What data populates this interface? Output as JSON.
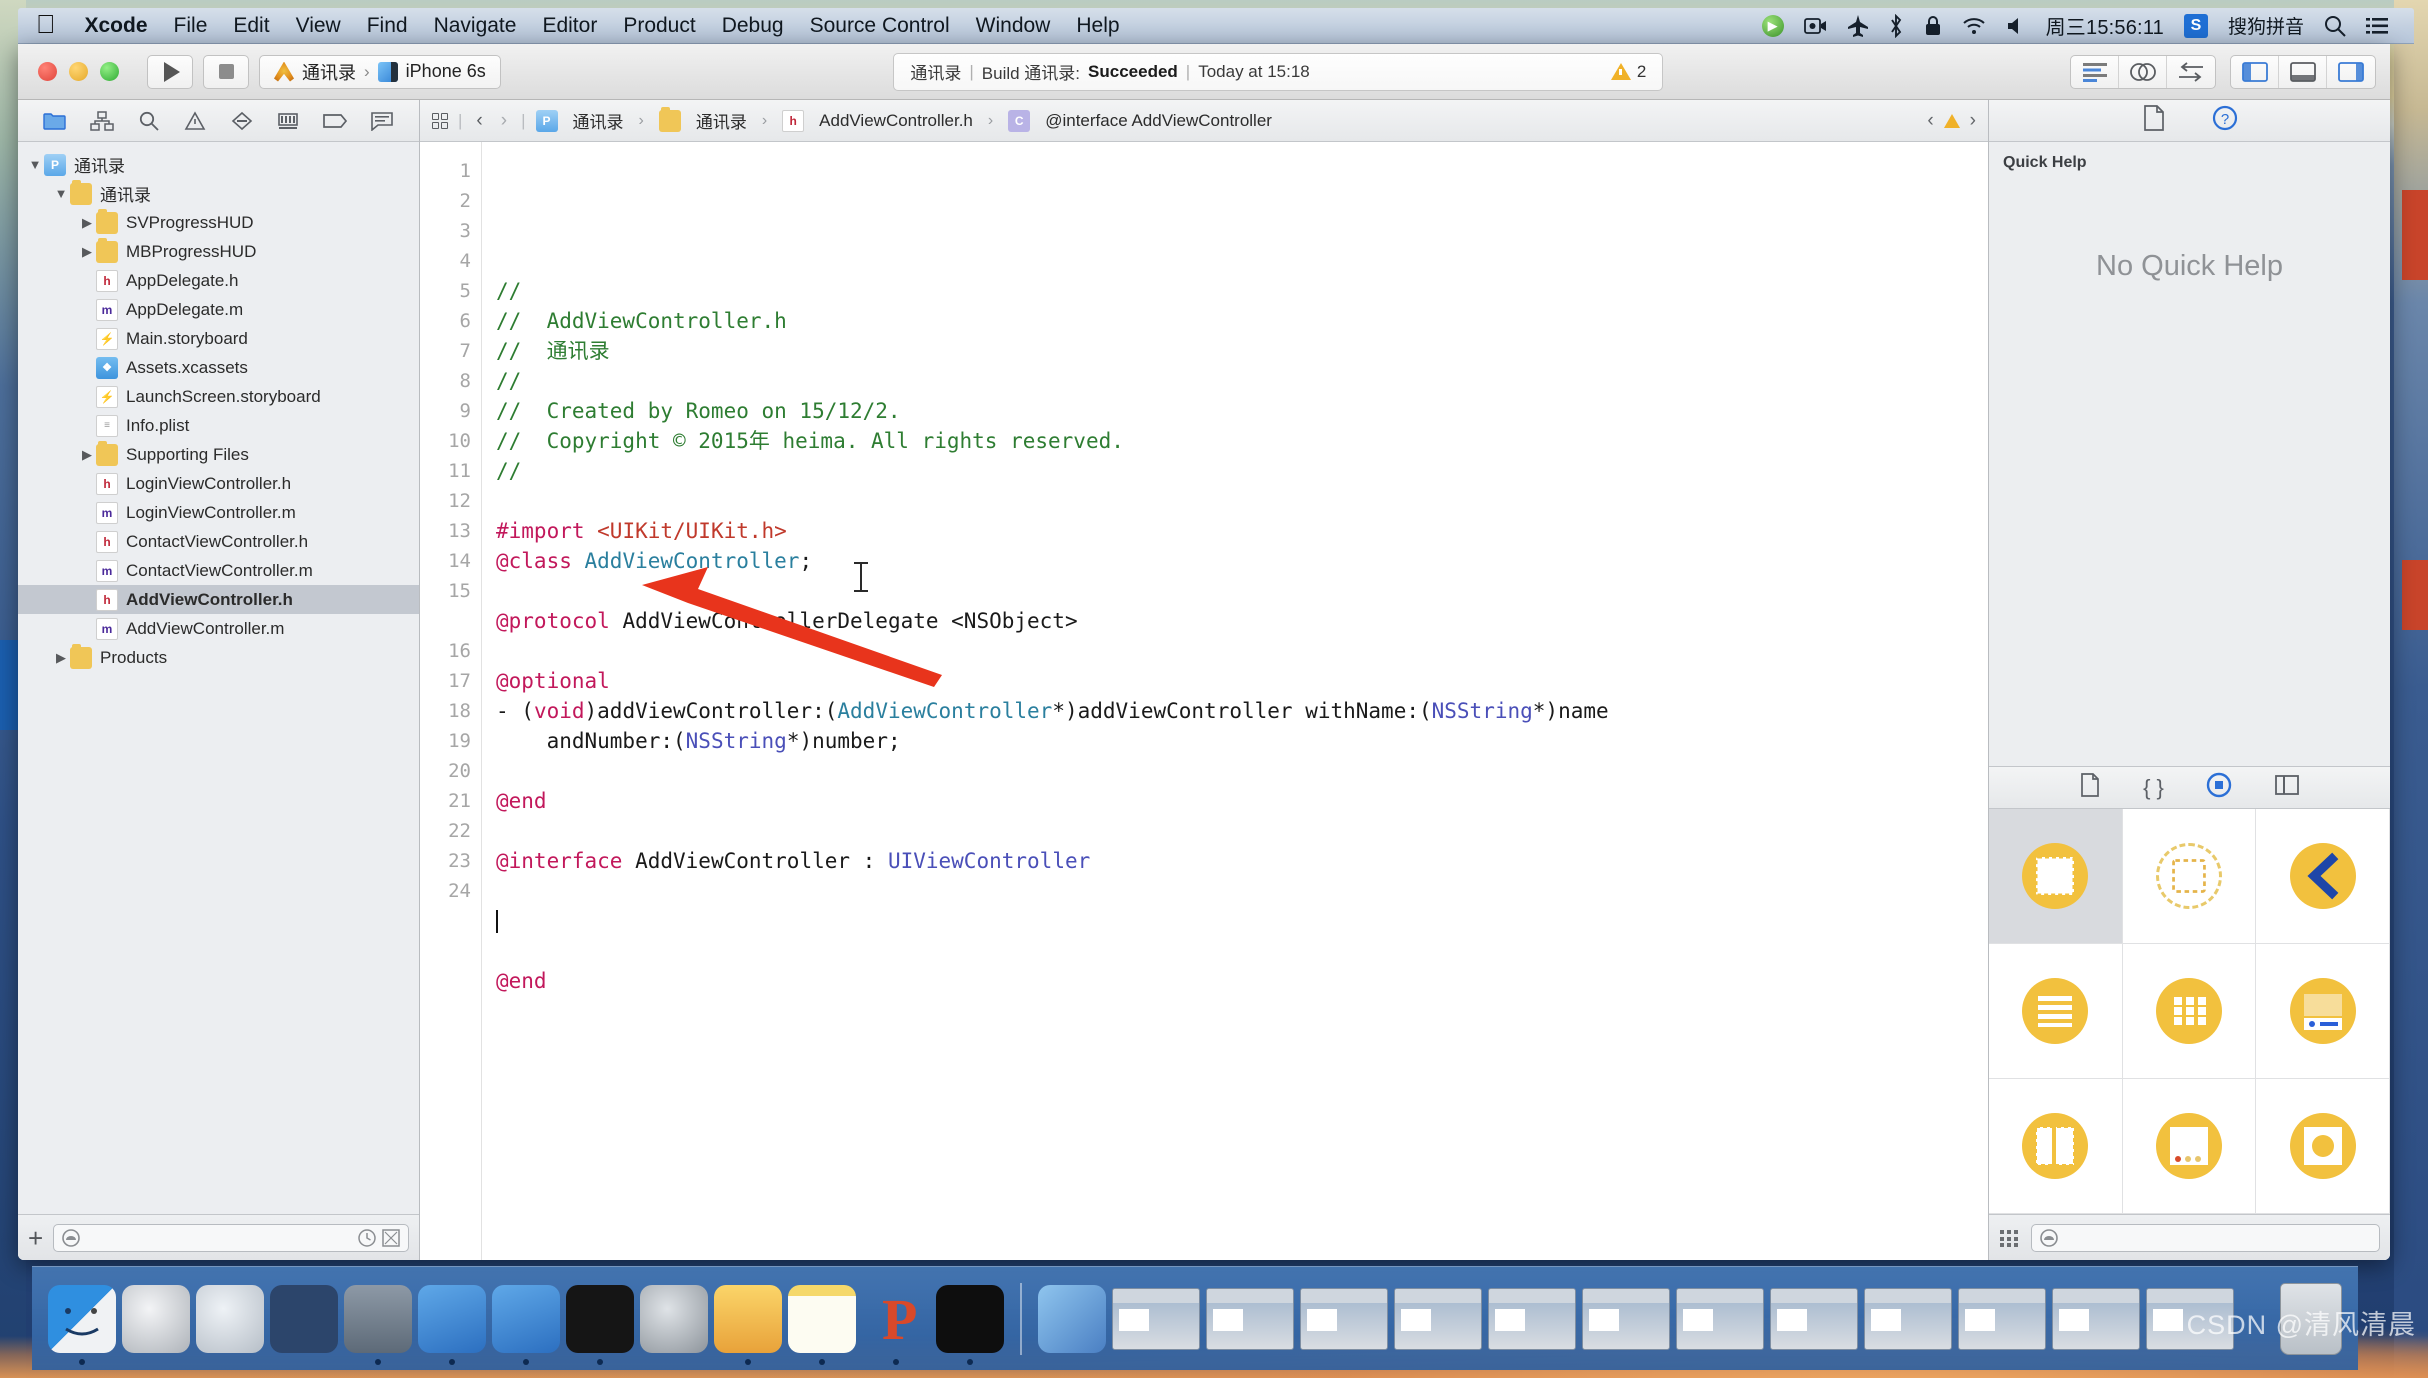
{
  "menubar": {
    "apple": "",
    "items": [
      {
        "label": "Xcode",
        "bold": true
      },
      {
        "label": "File",
        "bold": false
      },
      {
        "label": "Edit",
        "bold": false
      },
      {
        "label": "View",
        "bold": false
      },
      {
        "label": "Find",
        "bold": false
      },
      {
        "label": "Navigate",
        "bold": false
      },
      {
        "label": "Editor",
        "bold": false
      },
      {
        "label": "Product",
        "bold": false
      },
      {
        "label": "Debug",
        "bold": false
      },
      {
        "label": "Source Control",
        "bold": false
      },
      {
        "label": "Window",
        "bold": false
      },
      {
        "label": "Help",
        "bold": false
      }
    ],
    "status": {
      "clock": "周三15:56:11",
      "ime_badge": "S",
      "ime_label": "搜狗拼音",
      "icons": [
        "play-circle-icon",
        "screen-record-icon",
        "airplane-icon",
        "bluetooth-icon",
        "lock-icon",
        "wifi-icon",
        "volume-icon",
        "spotlight-search-icon",
        "notification-center-icon"
      ]
    }
  },
  "toolbar": {
    "run_label": "Run",
    "stop_label": "Stop",
    "scheme_project": "通讯录",
    "scheme_chevron": "›",
    "scheme_destination": "iPhone 6s",
    "activity": {
      "project": "通讯录",
      "sep": "|",
      "build_prefix": "Build 通讯录:",
      "build_status": "Succeeded",
      "time": "Today at 15:18",
      "warning_count": "2"
    },
    "right_buttons": [
      "standard-editor-icon",
      "assistant-editor-icon",
      "version-editor-icon",
      "toggle-navigator-icon",
      "toggle-debug-area-icon",
      "toggle-utilities-icon"
    ]
  },
  "navigator": {
    "tabs": [
      "project-navigator-icon",
      "symbol-navigator-icon",
      "find-navigator-icon",
      "issue-navigator-icon",
      "test-navigator-icon",
      "debug-navigator-icon",
      "breakpoint-navigator-icon",
      "report-navigator-icon"
    ],
    "active_tab_index": 0,
    "tree": [
      {
        "label": "通讯录",
        "indent": 0,
        "icon": "project",
        "disc": "open",
        "selected": false
      },
      {
        "label": "通讯录",
        "indent": 1,
        "icon": "folder",
        "disc": "open",
        "selected": false
      },
      {
        "label": "SVProgressHUD",
        "indent": 2,
        "icon": "folder",
        "disc": "closed",
        "selected": false
      },
      {
        "label": "MBProgressHUD",
        "indent": 2,
        "icon": "folder",
        "disc": "closed",
        "selected": false
      },
      {
        "label": "AppDelegate.h",
        "indent": 2,
        "icon": "h",
        "disc": "none",
        "selected": false
      },
      {
        "label": "AppDelegate.m",
        "indent": 2,
        "icon": "m",
        "disc": "none",
        "selected": false
      },
      {
        "label": "Main.storyboard",
        "indent": 2,
        "icon": "sb",
        "disc": "none",
        "selected": false
      },
      {
        "label": "Assets.xcassets",
        "indent": 2,
        "icon": "xcassets",
        "disc": "none",
        "selected": false
      },
      {
        "label": "LaunchScreen.storyboard",
        "indent": 2,
        "icon": "sb",
        "disc": "none",
        "selected": false
      },
      {
        "label": "Info.plist",
        "indent": 2,
        "icon": "plist",
        "disc": "none",
        "selected": false
      },
      {
        "label": "Supporting Files",
        "indent": 2,
        "icon": "folder",
        "disc": "closed",
        "selected": false
      },
      {
        "label": "LoginViewController.h",
        "indent": 2,
        "icon": "h",
        "disc": "none",
        "selected": false
      },
      {
        "label": "LoginViewController.m",
        "indent": 2,
        "icon": "m",
        "disc": "none",
        "selected": false
      },
      {
        "label": "ContactViewController.h",
        "indent": 2,
        "icon": "h",
        "disc": "none",
        "selected": false
      },
      {
        "label": "ContactViewController.m",
        "indent": 2,
        "icon": "m",
        "disc": "none",
        "selected": false
      },
      {
        "label": "AddViewController.h",
        "indent": 2,
        "icon": "h",
        "disc": "none",
        "selected": true
      },
      {
        "label": "AddViewController.m",
        "indent": 2,
        "icon": "m",
        "disc": "none",
        "selected": false
      },
      {
        "label": "Products",
        "indent": 1,
        "icon": "folder",
        "disc": "closed",
        "selected": false
      }
    ],
    "bottom": {
      "add_label": "+",
      "filter_placeholder": "",
      "recent_icon": "clock-icon",
      "source_control_icon": "source-control-filter-icon"
    }
  },
  "jumpbar": {
    "related_items_icon": "related-items-icon",
    "back_arrow": "‹",
    "forward_arrow": "›",
    "crumbs": [
      {
        "label": "通讯录",
        "icon": "project"
      },
      {
        "label": "通讯录",
        "icon": "folder"
      },
      {
        "label": "AddViewController.h",
        "icon": "h"
      },
      {
        "label": "@interface AddViewController",
        "icon": "interface"
      }
    ],
    "warning_count": ""
  },
  "editor": {
    "filename": "AddViewController.h",
    "line_count": 24,
    "lines": [
      {
        "n": 1,
        "tokens": [
          {
            "t": "//",
            "c": "c-comment"
          }
        ]
      },
      {
        "n": 2,
        "tokens": [
          {
            "t": "//  AddViewController.h",
            "c": "c-comment"
          }
        ]
      },
      {
        "n": 3,
        "tokens": [
          {
            "t": "//  通讯录",
            "c": "c-comment"
          }
        ]
      },
      {
        "n": 4,
        "tokens": [
          {
            "t": "//",
            "c": "c-comment"
          }
        ]
      },
      {
        "n": 5,
        "tokens": [
          {
            "t": "//  Created by Romeo on 15/12/2.",
            "c": "c-comment"
          }
        ]
      },
      {
        "n": 6,
        "tokens": [
          {
            "t": "//  Copyright © 2015年 heima. All rights reserved.",
            "c": "c-comment"
          }
        ]
      },
      {
        "n": 7,
        "tokens": [
          {
            "t": "//",
            "c": "c-comment"
          }
        ]
      },
      {
        "n": 8,
        "tokens": []
      },
      {
        "n": 9,
        "tokens": [
          {
            "t": "#import ",
            "c": "c-pre"
          },
          {
            "t": "<UIKit/UIKit.h>",
            "c": "c-str"
          }
        ]
      },
      {
        "n": 10,
        "tokens": [
          {
            "t": "@class",
            "c": "c-kw"
          },
          {
            "t": " ",
            "c": "c-plain"
          },
          {
            "t": "AddViewController",
            "c": "c-cls"
          },
          {
            "t": ";",
            "c": "c-plain"
          }
        ]
      },
      {
        "n": 11,
        "tokens": []
      },
      {
        "n": 12,
        "tokens": [
          {
            "t": "@protocol",
            "c": "c-kw"
          },
          {
            "t": " AddViewControllerDelegate <NSObject>",
            "c": "c-plain"
          }
        ]
      },
      {
        "n": 13,
        "tokens": []
      },
      {
        "n": 14,
        "tokens": [
          {
            "t": "@optional",
            "c": "c-kw"
          }
        ]
      },
      {
        "n": 15,
        "tokens": [
          {
            "t": "- (",
            "c": "c-plain"
          },
          {
            "t": "void",
            "c": "c-kw"
          },
          {
            "t": ")addViewController:(",
            "c": "c-plain"
          },
          {
            "t": "AddViewController",
            "c": "c-cls"
          },
          {
            "t": "*)addViewController withName:(",
            "c": "c-plain"
          },
          {
            "t": "NSString",
            "c": "c-type"
          },
          {
            "t": "*)name",
            "c": "c-plain"
          }
        ]
      },
      {
        "n": "",
        "tokens": [
          {
            "t": "    andNumber:(",
            "c": "c-plain"
          },
          {
            "t": "NSString",
            "c": "c-type"
          },
          {
            "t": "*)number;",
            "c": "c-plain"
          }
        ]
      },
      {
        "n": 16,
        "tokens": []
      },
      {
        "n": 17,
        "tokens": [
          {
            "t": "@end",
            "c": "c-kw"
          }
        ]
      },
      {
        "n": 18,
        "tokens": []
      },
      {
        "n": 19,
        "tokens": [
          {
            "t": "@interface",
            "c": "c-kw"
          },
          {
            "t": " AddViewController : ",
            "c": "c-plain"
          },
          {
            "t": "UIViewController",
            "c": "c-type"
          }
        ]
      },
      {
        "n": 20,
        "tokens": []
      },
      {
        "n": 21,
        "tokens": [
          {
            "t": "",
            "c": "c-plain",
            "caret": true
          }
        ]
      },
      {
        "n": 22,
        "tokens": []
      },
      {
        "n": 23,
        "tokens": [
          {
            "t": "@end",
            "c": "c-kw"
          }
        ]
      },
      {
        "n": 24,
        "tokens": []
      }
    ],
    "annotation": {
      "type": "red-arrow",
      "points_to_line": 21
    }
  },
  "utilities": {
    "tabs": [
      "file-inspector-icon",
      "quick-help-inspector-icon"
    ],
    "active_tab_index": 1,
    "quick_help": {
      "title": "Quick Help",
      "empty_message": "No Quick Help"
    },
    "library_tabs": [
      "file-template-library-icon",
      "code-snippet-library-icon",
      "object-library-icon",
      "media-library-icon"
    ],
    "library_active_index": 2,
    "library_objects": [
      {
        "name": "view-controller",
        "selected": true
      },
      {
        "name": "storyboard-reference",
        "selected": false
      },
      {
        "name": "navigation-controller",
        "selected": false
      },
      {
        "name": "table-view-controller",
        "selected": false
      },
      {
        "name": "collection-view-controller",
        "selected": false
      },
      {
        "name": "tab-bar-controller",
        "selected": false
      },
      {
        "name": "split-view-controller",
        "selected": false
      },
      {
        "name": "page-view-controller",
        "selected": false
      },
      {
        "name": "glkit-view-controller",
        "selected": false
      }
    ],
    "library_bottom": {
      "grid_icon": "grid-view-icon",
      "filter_placeholder": ""
    }
  },
  "dock": {
    "apps": [
      {
        "name": "finder",
        "running": true
      },
      {
        "name": "launchpad",
        "running": false
      },
      {
        "name": "safari",
        "running": false
      },
      {
        "name": "mouse-utility",
        "running": false
      },
      {
        "name": "quicktime-player",
        "running": true
      },
      {
        "name": "xcode",
        "running": true
      },
      {
        "name": "xcode-simulator",
        "running": true
      },
      {
        "name": "terminal",
        "running": true
      },
      {
        "name": "system-preferences",
        "running": false
      },
      {
        "name": "sketch",
        "running": true
      },
      {
        "name": "notes",
        "running": true
      },
      {
        "name": "pages-p",
        "running": true
      },
      {
        "name": "mac-mini",
        "running": true
      }
    ],
    "minimized": [
      {
        "name": "qq-player"
      },
      {
        "name": "window-thumb-1"
      },
      {
        "name": "window-thumb-2"
      },
      {
        "name": "window-thumb-3"
      },
      {
        "name": "window-thumb-4"
      },
      {
        "name": "window-thumb-5"
      },
      {
        "name": "window-thumb-6"
      },
      {
        "name": "window-thumb-7"
      },
      {
        "name": "window-thumb-8"
      },
      {
        "name": "window-thumb-9"
      },
      {
        "name": "window-thumb-10"
      },
      {
        "name": "window-thumb-11"
      },
      {
        "name": "window-thumb-12"
      }
    ],
    "trash": "trash"
  },
  "watermark": "CSDN @清风清晨"
}
